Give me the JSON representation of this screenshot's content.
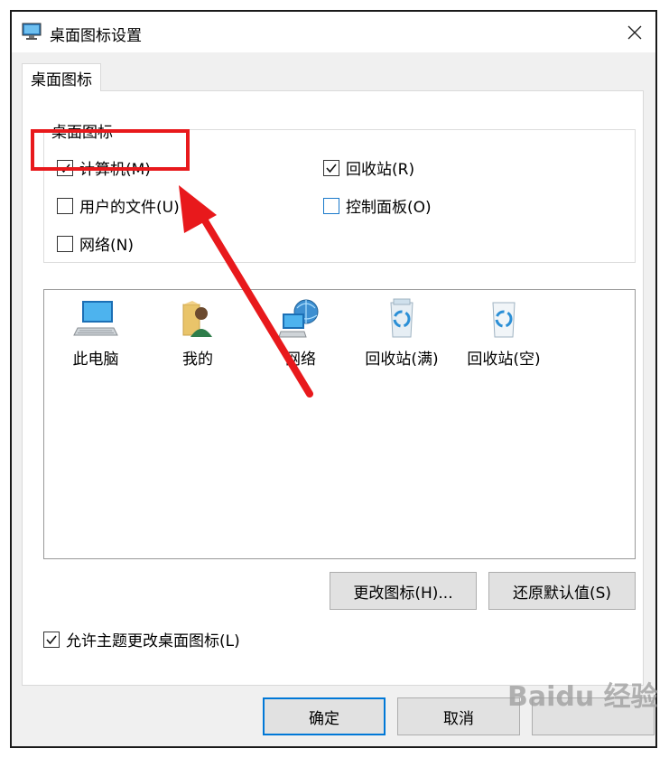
{
  "window": {
    "title": "桌面图标设置",
    "tab_label": "桌面图标"
  },
  "group": {
    "label": "桌面图标",
    "checkboxes": [
      {
        "label": "计算机(M)",
        "checked": true
      },
      {
        "label": "回收站(R)",
        "checked": true
      },
      {
        "label": "用户的文件(U)",
        "checked": false
      },
      {
        "label": "控制面板(O)",
        "checked": false
      },
      {
        "label": "网络(N)",
        "checked": false
      }
    ]
  },
  "preview": {
    "icons": [
      {
        "label": "此电脑",
        "icon": "computer-icon"
      },
      {
        "label": "我的",
        "icon": "user-folder-icon"
      },
      {
        "label": "网络",
        "icon": "network-icon"
      },
      {
        "label": "回收站(满)",
        "icon": "recycle-bin-full-icon"
      },
      {
        "label": "回收站(空)",
        "icon": "recycle-bin-empty-icon"
      }
    ]
  },
  "buttons": {
    "change_icon": "更改图标(H)...",
    "restore_default": "还原默认值(S)",
    "ok": "确定",
    "cancel": "取消"
  },
  "allow_themes": {
    "label": "允许主题更改桌面图标(L)",
    "checked": true
  },
  "watermark": "Baidu 经验",
  "colors": {
    "accent": "#0078d7",
    "annotation": "#e8191c"
  }
}
